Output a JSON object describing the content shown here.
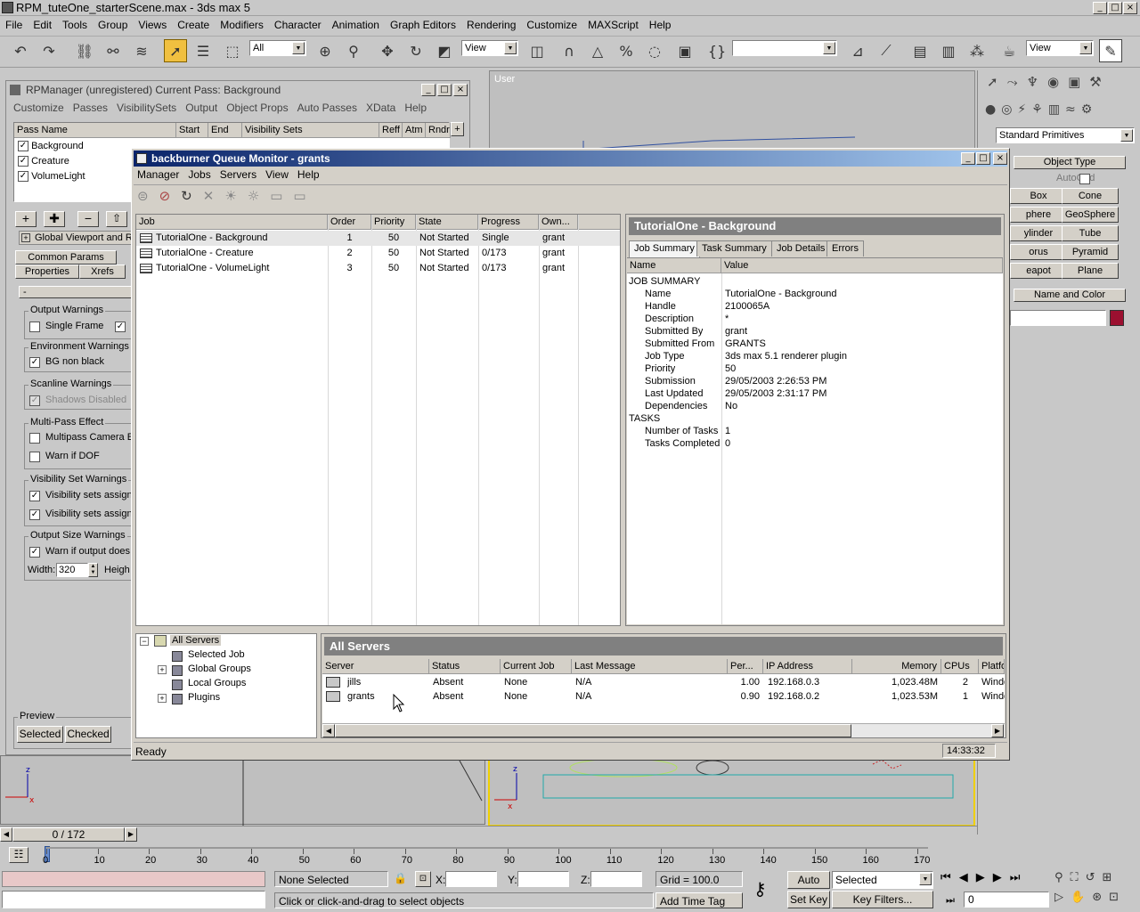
{
  "app": {
    "title": "RPM_tuteOne_starterScene.max - 3ds max 5"
  },
  "menu": [
    "File",
    "Edit",
    "Tools",
    "Group",
    "Views",
    "Create",
    "Modifiers",
    "Character",
    "Animation",
    "Graph Editors",
    "Rendering",
    "Customize",
    "MAXScript",
    "Help"
  ],
  "toolbar": {
    "selection_filter": "All",
    "ref_coord": "View",
    "ref_coord2": "View",
    "named_sel": ""
  },
  "viewport": {
    "label": "User"
  },
  "rpm": {
    "title": "RPManager (unregistered)  Current Pass: Background",
    "menu": [
      "Customize",
      "Passes",
      "VisibilitySets",
      "Output",
      "Object Props",
      "Auto Passes",
      "XData",
      "Help"
    ],
    "headers": [
      "Pass Name",
      "Start",
      "End",
      "Visibility Sets",
      "Reff",
      "Atm",
      "Rndr"
    ],
    "passes": [
      "Background",
      "Creature",
      "VolumeLight"
    ],
    "rollout": "Global Viewport and R",
    "tabs": [
      "Common Params",
      "Properties",
      "Xrefs"
    ],
    "collapse": "-",
    "groups": {
      "output": "Output Warnings",
      "env": "Environment Warnings",
      "scan": "Scanline Warnings",
      "mp": "Multi-Pass Effect",
      "vis": "Visibility Set Warnings",
      "size": "Output Size Warnings",
      "preview": "Preview"
    },
    "checks": {
      "single_frame": "Single Frame",
      "bg_non_black": "BG non black",
      "shadows": "Shadows Disabled",
      "mp_camera": "Multipass Camera Ef",
      "warn_dof": "Warn if DOF",
      "vis1": "Visibility sets assigne",
      "vis2": "Visibility sets assigne",
      "warn_output": "Warn if output does"
    },
    "width_label": "Width:",
    "width_value": "320",
    "height_label": "Heigh",
    "preview_buttons": [
      "Selected",
      "Checked"
    ]
  },
  "bb": {
    "title": "backburner Queue Monitor - grants",
    "menu": [
      "Manager",
      "Jobs",
      "Servers",
      "View",
      "Help"
    ],
    "job_headers": [
      "Job",
      "Order",
      "Priority",
      "State",
      "Progress",
      "Own..."
    ],
    "jobs": [
      {
        "name": "TutorialOne - Background",
        "order": "1",
        "priority": "50",
        "state": "Not Started",
        "progress": "Single",
        "owner": "grant"
      },
      {
        "name": "TutorialOne - Creature",
        "order": "2",
        "priority": "50",
        "state": "Not Started",
        "progress": "0/173",
        "owner": "grant"
      },
      {
        "name": "TutorialOne - VolumeLight",
        "order": "3",
        "priority": "50",
        "state": "Not Started",
        "progress": "0/173",
        "owner": "grant"
      }
    ],
    "detail_title": "TutorialOne - Background",
    "detail_tabs": [
      "Job Summary",
      "Task Summary",
      "Job Details",
      "Errors"
    ],
    "detail_headers": [
      "Name",
      "Value"
    ],
    "summary": [
      {
        "n": "JOB SUMMARY",
        "v": "",
        "sec": true
      },
      {
        "n": "Name",
        "v": "TutorialOne - Background"
      },
      {
        "n": "Handle",
        "v": "2100065A"
      },
      {
        "n": "Description",
        "v": "*"
      },
      {
        "n": "Submitted By",
        "v": "grant"
      },
      {
        "n": "Submitted From",
        "v": "GRANTS"
      },
      {
        "n": "Job Type",
        "v": "3ds max 5.1 renderer plugin"
      },
      {
        "n": "Priority",
        "v": "50"
      },
      {
        "n": "Submission",
        "v": "29/05/2003 2:26:53 PM"
      },
      {
        "n": "Last Updated",
        "v": "29/05/2003 2:31:17 PM"
      },
      {
        "n": "Dependencies",
        "v": "No"
      },
      {
        "n": "TASKS",
        "v": "",
        "sec": true
      },
      {
        "n": "Number of Tasks",
        "v": "1"
      },
      {
        "n": "Tasks Completed",
        "v": "0"
      }
    ],
    "tree": [
      "All Servers",
      "Selected Job",
      "Global Groups",
      "Local Groups",
      "Plugins"
    ],
    "servers_title": "All Servers",
    "server_headers": [
      "Server",
      "Status",
      "Current Job",
      "Last Message",
      "Per...",
      "IP Address",
      "Memory",
      "CPUs",
      "Platfo"
    ],
    "servers": [
      {
        "name": "jills",
        "status": "Absent",
        "job": "None",
        "msg": "N/A",
        "per": "1.00",
        "ip": "192.168.0.3",
        "mem": "1,023.48M",
        "cpus": "2",
        "plat": "Windo"
      },
      {
        "name": "grants",
        "status": "Absent",
        "job": "None",
        "msg": "N/A",
        "per": "0.90",
        "ip": "192.168.0.2",
        "mem": "1,023.53M",
        "cpus": "1",
        "plat": "Windo"
      }
    ],
    "status": "Ready",
    "time": "14:33:32"
  },
  "cmd": {
    "dropdown": "Standard Primitives",
    "object_type": "Object Type",
    "autogrid": "AutoGrid",
    "prims": [
      "Box",
      "Cone",
      "phere",
      "GeoSphere",
      "ylinder",
      "Tube",
      "orus",
      "Pyramid",
      "eapot",
      "Plane"
    ],
    "name_color": "Name and Color",
    "swatch": "#9c1030"
  },
  "timeline": {
    "counter": "0 / 172",
    "ticks": [
      "0",
      "10",
      "20",
      "30",
      "40",
      "50",
      "60",
      "70",
      "80",
      "90",
      "100",
      "110",
      "120",
      "130",
      "140",
      "150",
      "160",
      "170"
    ]
  },
  "status": {
    "selection": "None Selected",
    "x": "X:",
    "y": "Y:",
    "z": "Z:",
    "grid": "Grid = 100.0",
    "prompt": "Click or click-and-drag to select objects",
    "add_time_tag": "Add Time Tag",
    "auto_key": "Auto Key",
    "set_key": "Set Key",
    "key_mode": "Selected",
    "key_filters": "Key Filters...",
    "frame": "0"
  }
}
